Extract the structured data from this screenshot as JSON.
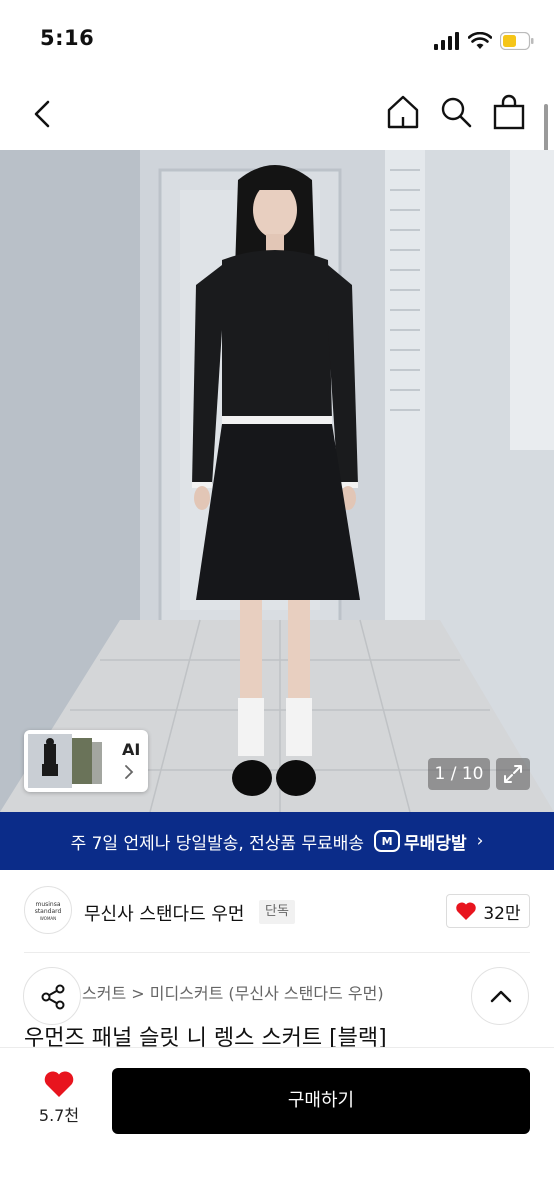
{
  "status_bar": {
    "time": "5:16",
    "battery_color": "#f5c518"
  },
  "nav": {
    "back_icon": "chevron-left-icon",
    "home_icon": "home-icon",
    "search_icon": "search-icon",
    "bag_icon": "shopping-bag-icon"
  },
  "gallery": {
    "ai_label": "AI",
    "ai_chevron": "›",
    "page_counter": "1 / 10",
    "expand_icon": "expand-icon"
  },
  "delivery_banner": {
    "text": "주 7일 언제나 당일발송, 전상품 무료배송",
    "badge_logo": "M",
    "badge_label": "무배당발",
    "chevron": "›",
    "background": "#0b2c89"
  },
  "brand": {
    "logo_line1": "musinsa",
    "logo_line2": "standard",
    "logo_line3": "WOMAN",
    "name": "무신사 스탠다드 우먼",
    "exclusive_badge": "단독",
    "like_count": "32만"
  },
  "product": {
    "breadcrumb": "스커트 > 미디스커트 (무신사 스탠다드 우먼)",
    "title": "우먼즈 패널 슬릿 니 렝스 스커트 [블랙]"
  },
  "bottom_bar": {
    "wish_count": "5.7천",
    "buy_label": "구매하기",
    "heart_color": "#e8141e"
  }
}
